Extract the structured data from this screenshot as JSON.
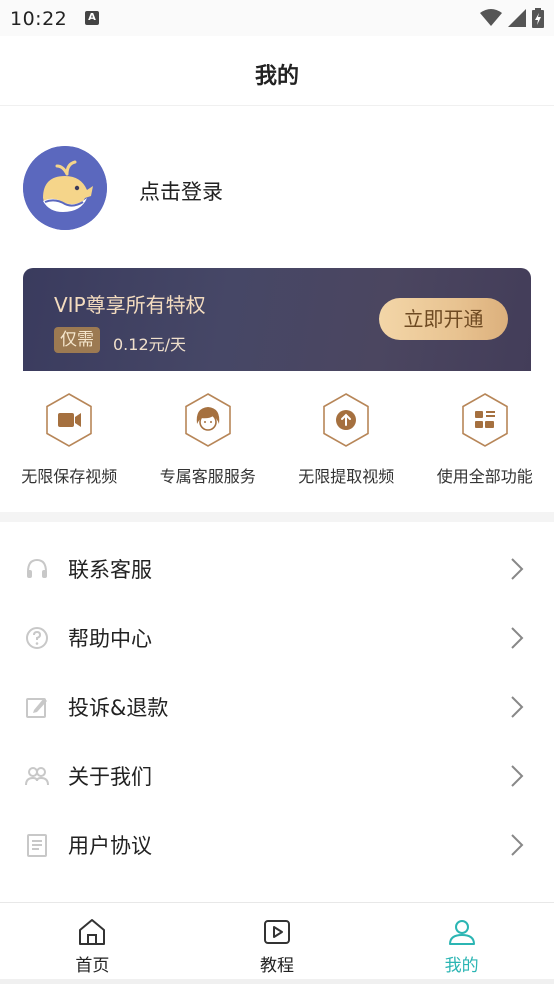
{
  "status_bar": {
    "time": "10:22",
    "notification_letter": "A"
  },
  "header": {
    "title": "我的"
  },
  "profile": {
    "login_text": "点击登录"
  },
  "vip": {
    "title": "VIP尊享所有特权",
    "price_tag": "仅需",
    "price": "0.12元/天",
    "button_label": "立即开通",
    "colors": {
      "card": "#3f405f",
      "gold": "#e8c391"
    }
  },
  "features": [
    {
      "icon": "video-camera-icon",
      "label": "无限保存视频"
    },
    {
      "icon": "customer-service-icon",
      "label": "专属客服服务"
    },
    {
      "icon": "upload-icon",
      "label": "无限提取视频"
    },
    {
      "icon": "apps-grid-icon",
      "label": "使用全部功能"
    }
  ],
  "menu": [
    {
      "icon": "headset-icon",
      "label": "联系客服"
    },
    {
      "icon": "help-icon",
      "label": "帮助中心"
    },
    {
      "icon": "edit-icon",
      "label": "投诉&退款"
    },
    {
      "icon": "users-icon",
      "label": "关于我们"
    },
    {
      "icon": "document-icon",
      "label": "用户协议"
    }
  ],
  "tabs": [
    {
      "icon": "home-icon",
      "label": "首页",
      "active": false
    },
    {
      "icon": "play-icon",
      "label": "教程",
      "active": false
    },
    {
      "icon": "user-icon",
      "label": "我的",
      "active": true
    }
  ],
  "colors": {
    "accent": "#2bb5b3",
    "feature_brown": "#a5703f"
  }
}
